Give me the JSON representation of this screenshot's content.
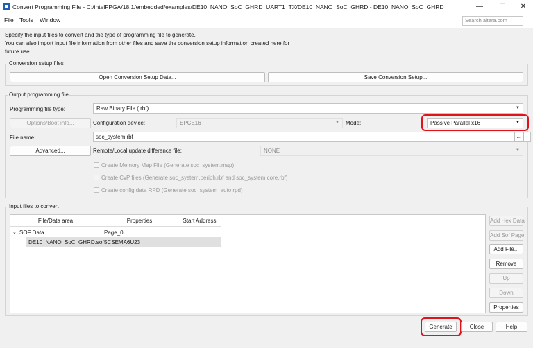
{
  "window": {
    "title": "Convert Programming File - C:/intelFPGA/18.1/embedded/examples/DE10_NANO_SoC_GHRD_UART1_TX/DE10_NANO_SoC_GHRD - DE10_NANO_SoC_GHRD",
    "minimize": "—",
    "maximize": "☐",
    "close": "✕"
  },
  "menu": {
    "file": "File",
    "tools": "Tools",
    "window": "Window",
    "search_placeholder": "Search altera.com"
  },
  "intro": {
    "line1": "Specify the input files to convert and the type of programming file to generate.",
    "line2": "You can also import input file information from other files and save the conversion setup information created here for",
    "line3": "future use."
  },
  "conversion_setup": {
    "label": "Conversion setup files",
    "open_button": "Open Conversion Setup Data...",
    "save_button": "Save Conversion Setup..."
  },
  "output": {
    "label": "Output programming file",
    "file_type_label": "Programming file type:",
    "file_type_value": "Raw Binary File (.rbf)",
    "options_button": "Options/Boot info...",
    "config_device_label": "Configuration device:",
    "config_device_value": "EPCE16",
    "mode_label": "Mode:",
    "mode_value": "Passive Parallel x16",
    "file_name_label": "File name:",
    "file_name_value": "soc_system.rbf",
    "browse_button": "...",
    "advanced_button": "Advanced...",
    "remote_label": "Remote/Local update difference file:",
    "remote_value": "NONE",
    "check_memory_map": "Create Memory Map File (Generate soc_system.map)",
    "check_cvp": "Create CvP files (Generate soc_system.periph.rbf and soc_system.core.rbf)",
    "check_rpd": "Create config data RPD (Generate soc_system_auto.rpd)"
  },
  "input_files": {
    "label": "Input files to convert",
    "columns": [
      "File/Data area",
      "Properties",
      "Start Address"
    ],
    "group_name": "SOF Data",
    "group_property": "Page_0",
    "file_name": "DE10_NANO_SoC_GHRD.sof",
    "file_property": "5CSEMA6U23",
    "buttons": {
      "add_hex": "Add Hex Data",
      "add_sof_page": "Add Sof Page",
      "add_file": "Add File...",
      "remove": "Remove",
      "up": "Up",
      "down": "Down",
      "properties": "Properties"
    }
  },
  "footer": {
    "generate": "Generate",
    "close": "Close",
    "help": "Help"
  },
  "colors": {
    "highlight": "#e0121b",
    "dialog_bg": "#f0f0f0",
    "icon_blue": "#1f5fb8"
  }
}
